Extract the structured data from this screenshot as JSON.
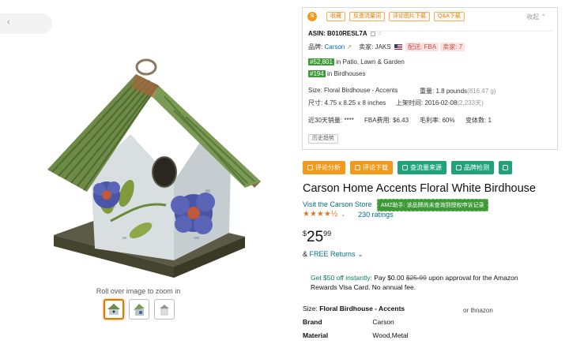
{
  "extension": {
    "tabs": [
      "收藏",
      "反查流量词",
      "评论图片下载",
      "Q&A下载"
    ],
    "collapse": "收起 ⌃",
    "asin_label": "ASIN:",
    "asin_value": "B010RESL7A",
    "brand_label": "品牌:",
    "brand_value": "Carson",
    "seller_label": "卖家:",
    "seller_value": "JAKS",
    "fulfillment": "配送: FBA",
    "sellers_count": "卖家: 7",
    "rank1": "#52,801",
    "rank1_category": "in Patio, Lawn & Garden",
    "rank2": "#194",
    "rank2_category": "in Birdhouses",
    "size_label": "Size:",
    "size_value": "Floral Birdhouse - Accents",
    "weight_label": "重量:",
    "weight_value": "1.8 pounds",
    "weight_grams": "(816.47 g)",
    "dims_label": "尺寸:",
    "dims_value": "4.75 x 8.25 x 8 inches",
    "launch_label": "上架时间:",
    "launch_value": "2016-02-08",
    "launch_days": "(2,233天)",
    "sales_label": "近30天销量:",
    "sales_value": "****",
    "fba_fee_label": "FBA费用:",
    "fba_fee_value": "$6.43",
    "margin_label": "毛利率:",
    "margin_value": "60%",
    "variants_label": "变体数:",
    "variants_value": "1",
    "history_button": "历史趋势"
  },
  "actions": [
    "评论分析",
    "评论下载",
    "查流量来源",
    "品牌检测"
  ],
  "product": {
    "title": "Carson Home Accents Floral White Birdhouse",
    "store_link": "Visit the Carson Store",
    "amz_badge": "AMZ助手: 该品牌尚未查询到授权申诉记录",
    "stars": "★★★★½",
    "rating_caret": "⌄",
    "ratings_count": "230 ratings",
    "price_currency": "$",
    "price_whole": "25",
    "price_fraction": "99",
    "returns_prefix": "&",
    "returns_label": "FREE Returns",
    "returns_caret": "⌄",
    "promo_highlight": "Get $50 off instantly:",
    "promo_pay": "Pay $0.00",
    "promo_strike": "$25.99",
    "promo_rest": "upon approval for the Amazon Rewards Visa Card. No annual fee.",
    "size_label": "Size:",
    "size_value": "Floral Birdhouse - Accents",
    "overlap_text": "or thnazon",
    "attributes": [
      {
        "key": "Brand",
        "value": "Carson"
      },
      {
        "key": "Material",
        "value": "Wood,Metal"
      }
    ]
  },
  "gallery": {
    "zoom_hint": "Roll over image to zoom in",
    "back_arrow": "‹"
  },
  "colors": {
    "accent_orange": "#f19a1c",
    "accent_green": "#21a37a",
    "rank_green": "#3e9a37",
    "link_teal": "#007185",
    "star": "#de7921"
  }
}
